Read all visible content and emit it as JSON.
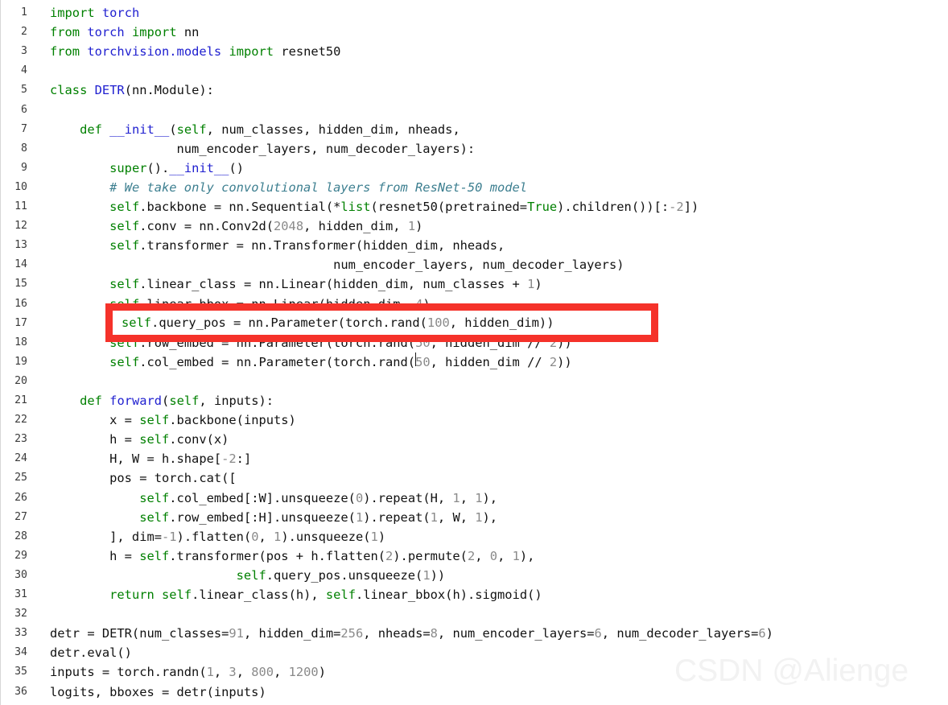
{
  "editor": {
    "language": "python",
    "background_color": "#ffffff",
    "gutter_color": "#3b3b3b",
    "colors": {
      "keyword": "#008000",
      "name": "#2020d0",
      "number": "#8a8a8a",
      "comment": "#3d7f90",
      "plain": "#111111",
      "annotation": "#f5322a"
    },
    "first_line_number": 1,
    "last_line_number": 36
  },
  "watermark": {
    "text": "CSDN @Alienge"
  },
  "annotation": {
    "type": "red-rectangle",
    "highlighted_line": 17,
    "highlighted_text": "self.query_pos = nn.Parameter(torch.rand(100, hidden_dim))"
  },
  "lines": [
    {
      "n": "1",
      "tokens": [
        {
          "t": "import",
          "c": "kw"
        },
        {
          "t": " ",
          "c": "pl"
        },
        {
          "t": "torch",
          "c": "nm"
        }
      ]
    },
    {
      "n": "2",
      "tokens": [
        {
          "t": "from",
          "c": "kw"
        },
        {
          "t": " ",
          "c": "pl"
        },
        {
          "t": "torch",
          "c": "nm"
        },
        {
          "t": " ",
          "c": "pl"
        },
        {
          "t": "import",
          "c": "kw"
        },
        {
          "t": " nn",
          "c": "pl"
        }
      ]
    },
    {
      "n": "3",
      "tokens": [
        {
          "t": "from",
          "c": "kw"
        },
        {
          "t": " ",
          "c": "pl"
        },
        {
          "t": "torchvision.models",
          "c": "nm"
        },
        {
          "t": " ",
          "c": "pl"
        },
        {
          "t": "import",
          "c": "kw"
        },
        {
          "t": " resnet50",
          "c": "pl"
        }
      ]
    },
    {
      "n": "4",
      "tokens": []
    },
    {
      "n": "5",
      "tokens": [
        {
          "t": "class",
          "c": "kw"
        },
        {
          "t": " ",
          "c": "pl"
        },
        {
          "t": "DETR",
          "c": "nm"
        },
        {
          "t": "(nn.Module):",
          "c": "pl"
        }
      ]
    },
    {
      "n": "6",
      "tokens": []
    },
    {
      "n": "7",
      "tokens": [
        {
          "t": "    ",
          "c": "pl"
        },
        {
          "t": "def",
          "c": "kw"
        },
        {
          "t": " ",
          "c": "pl"
        },
        {
          "t": "__init__",
          "c": "nm"
        },
        {
          "t": "(",
          "c": "pl"
        },
        {
          "t": "self",
          "c": "kw"
        },
        {
          "t": ", num_classes, hidden_dim, nheads,",
          "c": "pl"
        }
      ]
    },
    {
      "n": "8",
      "tokens": [
        {
          "t": "                 num_encoder_layers, num_decoder_layers):",
          "c": "pl"
        }
      ]
    },
    {
      "n": "9",
      "tokens": [
        {
          "t": "        ",
          "c": "pl"
        },
        {
          "t": "super",
          "c": "kw"
        },
        {
          "t": "().",
          "c": "pl"
        },
        {
          "t": "__init__",
          "c": "nm"
        },
        {
          "t": "()",
          "c": "pl"
        }
      ]
    },
    {
      "n": "10",
      "tokens": [
        {
          "t": "        ",
          "c": "pl"
        },
        {
          "t": "# We take only convolutional layers from ResNet-50 model",
          "c": "cm"
        }
      ]
    },
    {
      "n": "11",
      "tokens": [
        {
          "t": "        ",
          "c": "pl"
        },
        {
          "t": "self",
          "c": "kw"
        },
        {
          "t": ".backbone = nn.Sequential(*",
          "c": "pl"
        },
        {
          "t": "list",
          "c": "kw"
        },
        {
          "t": "(resnet50(pretrained=",
          "c": "pl"
        },
        {
          "t": "True",
          "c": "kw"
        },
        {
          "t": ").children())[:",
          "c": "pl"
        },
        {
          "t": "-2",
          "c": "num"
        },
        {
          "t": "])",
          "c": "pl"
        }
      ]
    },
    {
      "n": "12",
      "tokens": [
        {
          "t": "        ",
          "c": "pl"
        },
        {
          "t": "self",
          "c": "kw"
        },
        {
          "t": ".conv = nn.Conv2d(",
          "c": "pl"
        },
        {
          "t": "2048",
          "c": "num"
        },
        {
          "t": ", hidden_dim, ",
          "c": "pl"
        },
        {
          "t": "1",
          "c": "num"
        },
        {
          "t": ")",
          "c": "pl"
        }
      ]
    },
    {
      "n": "13",
      "tokens": [
        {
          "t": "        ",
          "c": "pl"
        },
        {
          "t": "self",
          "c": "kw"
        },
        {
          "t": ".transformer = nn.Transformer(hidden_dim, nheads,",
          "c": "pl"
        }
      ]
    },
    {
      "n": "14",
      "tokens": [
        {
          "t": "                                      num_encoder_layers, num_decoder_layers)",
          "c": "pl"
        }
      ]
    },
    {
      "n": "15",
      "tokens": [
        {
          "t": "        ",
          "c": "pl"
        },
        {
          "t": "self",
          "c": "kw"
        },
        {
          "t": ".linear_class = nn.Linear(hidden_dim, num_classes + ",
          "c": "pl"
        },
        {
          "t": "1",
          "c": "num"
        },
        {
          "t": ")",
          "c": "pl"
        }
      ]
    },
    {
      "n": "16",
      "tokens": [
        {
          "t": "        ",
          "c": "pl"
        },
        {
          "t": "self",
          "c": "kw"
        },
        {
          "t": ".linear_bbox = nn.Linear(hidden_dim, ",
          "c": "pl"
        },
        {
          "t": "4",
          "c": "num"
        },
        {
          "t": ")",
          "c": "pl"
        }
      ]
    },
    {
      "n": "17",
      "tokens": [
        {
          "t": "        ",
          "c": "pl"
        },
        {
          "t": "self",
          "c": "kw"
        },
        {
          "t": ".query_pos = nn.Parameter(torch.rand(",
          "c": "pl"
        },
        {
          "t": "100",
          "c": "num"
        },
        {
          "t": ", hidden_dim))",
          "c": "pl"
        }
      ]
    },
    {
      "n": "18",
      "tokens": [
        {
          "t": "        ",
          "c": "pl"
        },
        {
          "t": "self",
          "c": "kw"
        },
        {
          "t": ".row_embed = nn.Parameter(torch.rand(",
          "c": "pl"
        },
        {
          "t": "50",
          "c": "num"
        },
        {
          "t": ", hidden_dim // ",
          "c": "pl"
        },
        {
          "t": "2",
          "c": "num"
        },
        {
          "t": "))",
          "c": "pl"
        }
      ]
    },
    {
      "n": "19",
      "tokens": [
        {
          "t": "        ",
          "c": "pl"
        },
        {
          "t": "self",
          "c": "kw"
        },
        {
          "t": ".col_embed = nn.Parameter(torch.rand(",
          "c": "pl"
        },
        {
          "t": "50",
          "c": "num"
        },
        {
          "t": ", hidden_dim // ",
          "c": "pl"
        },
        {
          "t": "2",
          "c": "num"
        },
        {
          "t": "))",
          "c": "pl"
        }
      ]
    },
    {
      "n": "20",
      "tokens": []
    },
    {
      "n": "21",
      "tokens": [
        {
          "t": "    ",
          "c": "pl"
        },
        {
          "t": "def",
          "c": "kw"
        },
        {
          "t": " ",
          "c": "pl"
        },
        {
          "t": "forward",
          "c": "nm"
        },
        {
          "t": "(",
          "c": "pl"
        },
        {
          "t": "self",
          "c": "kw"
        },
        {
          "t": ", inputs):",
          "c": "pl"
        }
      ]
    },
    {
      "n": "22",
      "tokens": [
        {
          "t": "        x = ",
          "c": "pl"
        },
        {
          "t": "self",
          "c": "kw"
        },
        {
          "t": ".backbone(inputs)",
          "c": "pl"
        }
      ]
    },
    {
      "n": "23",
      "tokens": [
        {
          "t": "        h = ",
          "c": "pl"
        },
        {
          "t": "self",
          "c": "kw"
        },
        {
          "t": ".conv(x)",
          "c": "pl"
        }
      ]
    },
    {
      "n": "24",
      "tokens": [
        {
          "t": "        H, W = h.shape[",
          "c": "pl"
        },
        {
          "t": "-2",
          "c": "num"
        },
        {
          "t": ":]",
          "c": "pl"
        }
      ]
    },
    {
      "n": "25",
      "tokens": [
        {
          "t": "        pos = torch.cat([",
          "c": "pl"
        }
      ]
    },
    {
      "n": "26",
      "tokens": [
        {
          "t": "            ",
          "c": "pl"
        },
        {
          "t": "self",
          "c": "kw"
        },
        {
          "t": ".col_embed[:W].unsqueeze(",
          "c": "pl"
        },
        {
          "t": "0",
          "c": "num"
        },
        {
          "t": ").repeat(H, ",
          "c": "pl"
        },
        {
          "t": "1",
          "c": "num"
        },
        {
          "t": ", ",
          "c": "pl"
        },
        {
          "t": "1",
          "c": "num"
        },
        {
          "t": "),",
          "c": "pl"
        }
      ]
    },
    {
      "n": "27",
      "tokens": [
        {
          "t": "            ",
          "c": "pl"
        },
        {
          "t": "self",
          "c": "kw"
        },
        {
          "t": ".row_embed[:H].unsqueeze(",
          "c": "pl"
        },
        {
          "t": "1",
          "c": "num"
        },
        {
          "t": ").repeat(",
          "c": "pl"
        },
        {
          "t": "1",
          "c": "num"
        },
        {
          "t": ", W, ",
          "c": "pl"
        },
        {
          "t": "1",
          "c": "num"
        },
        {
          "t": "),",
          "c": "pl"
        }
      ]
    },
    {
      "n": "28",
      "tokens": [
        {
          "t": "        ], dim=",
          "c": "pl"
        },
        {
          "t": "-1",
          "c": "num"
        },
        {
          "t": ").flatten(",
          "c": "pl"
        },
        {
          "t": "0",
          "c": "num"
        },
        {
          "t": ", ",
          "c": "pl"
        },
        {
          "t": "1",
          "c": "num"
        },
        {
          "t": ").unsqueeze(",
          "c": "pl"
        },
        {
          "t": "1",
          "c": "num"
        },
        {
          "t": ")",
          "c": "pl"
        }
      ]
    },
    {
      "n": "29",
      "tokens": [
        {
          "t": "        h = ",
          "c": "pl"
        },
        {
          "t": "self",
          "c": "kw"
        },
        {
          "t": ".transformer(pos + h.flatten(",
          "c": "pl"
        },
        {
          "t": "2",
          "c": "num"
        },
        {
          "t": ").permute(",
          "c": "pl"
        },
        {
          "t": "2",
          "c": "num"
        },
        {
          "t": ", ",
          "c": "pl"
        },
        {
          "t": "0",
          "c": "num"
        },
        {
          "t": ", ",
          "c": "pl"
        },
        {
          "t": "1",
          "c": "num"
        },
        {
          "t": "),",
          "c": "pl"
        }
      ]
    },
    {
      "n": "30",
      "tokens": [
        {
          "t": "                         ",
          "c": "pl"
        },
        {
          "t": "self",
          "c": "kw"
        },
        {
          "t": ".query_pos.unsqueeze(",
          "c": "pl"
        },
        {
          "t": "1",
          "c": "num"
        },
        {
          "t": "))",
          "c": "pl"
        }
      ]
    },
    {
      "n": "31",
      "tokens": [
        {
          "t": "        ",
          "c": "pl"
        },
        {
          "t": "return",
          "c": "kw"
        },
        {
          "t": " ",
          "c": "pl"
        },
        {
          "t": "self",
          "c": "kw"
        },
        {
          "t": ".linear_class(h), ",
          "c": "pl"
        },
        {
          "t": "self",
          "c": "kw"
        },
        {
          "t": ".linear_bbox(h).sigmoid()",
          "c": "pl"
        }
      ]
    },
    {
      "n": "32",
      "tokens": []
    },
    {
      "n": "33",
      "tokens": [
        {
          "t": "detr = DETR(num_classes=",
          "c": "pl"
        },
        {
          "t": "91",
          "c": "num"
        },
        {
          "t": ", hidden_dim=",
          "c": "pl"
        },
        {
          "t": "256",
          "c": "num"
        },
        {
          "t": ", nheads=",
          "c": "pl"
        },
        {
          "t": "8",
          "c": "num"
        },
        {
          "t": ", num_encoder_layers=",
          "c": "pl"
        },
        {
          "t": "6",
          "c": "num"
        },
        {
          "t": ", num_decoder_layers=",
          "c": "pl"
        },
        {
          "t": "6",
          "c": "num"
        },
        {
          "t": ")",
          "c": "pl"
        }
      ]
    },
    {
      "n": "34",
      "tokens": [
        {
          "t": "detr.eval()",
          "c": "pl"
        }
      ]
    },
    {
      "n": "35",
      "tokens": [
        {
          "t": "inputs = torch.randn(",
          "c": "pl"
        },
        {
          "t": "1",
          "c": "num"
        },
        {
          "t": ", ",
          "c": "pl"
        },
        {
          "t": "3",
          "c": "num"
        },
        {
          "t": ", ",
          "c": "pl"
        },
        {
          "t": "800",
          "c": "num"
        },
        {
          "t": ", ",
          "c": "pl"
        },
        {
          "t": "1200",
          "c": "num"
        },
        {
          "t": ")",
          "c": "pl"
        }
      ]
    },
    {
      "n": "36",
      "tokens": [
        {
          "t": "logits, bboxes = detr(inputs)",
          "c": "pl"
        }
      ]
    }
  ],
  "highlight_line_tokens": [
    {
      "t": "self",
      "c": "kw"
    },
    {
      "t": ".query_pos = nn.Parameter(torch.rand(",
      "c": "pl"
    },
    {
      "t": "100",
      "c": "num"
    },
    {
      "t": ", hidden_dim))",
      "c": "pl"
    }
  ]
}
